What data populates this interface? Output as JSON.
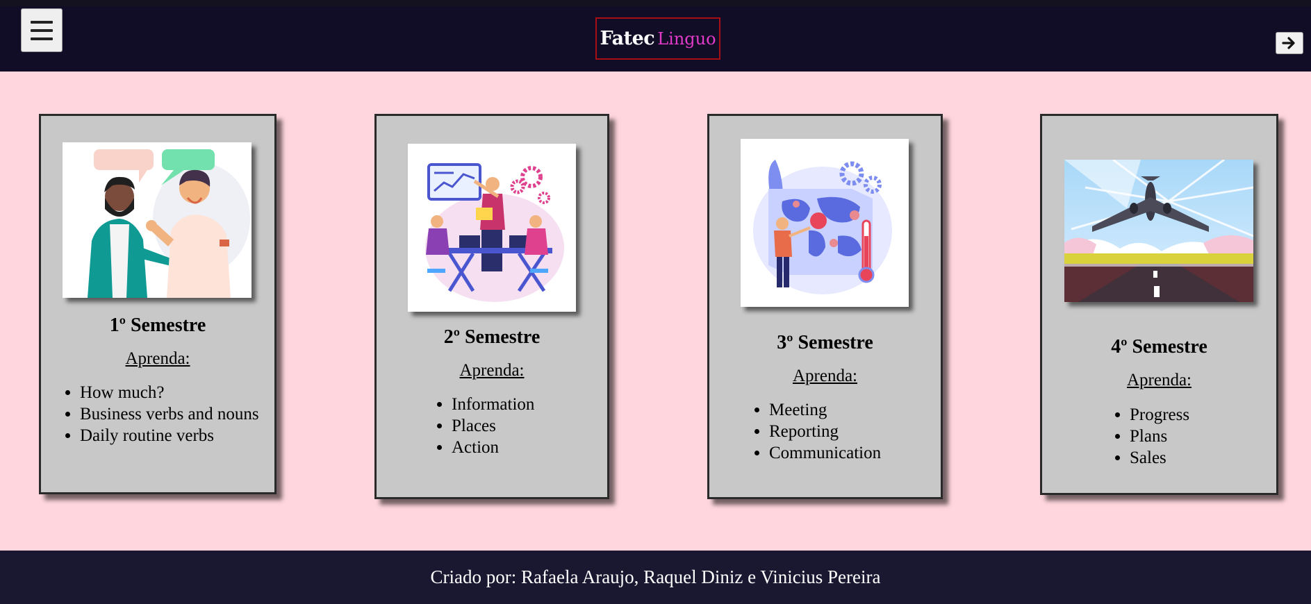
{
  "header": {
    "logo_part1": "Fatec",
    "logo_part2": "Linguo",
    "colors": {
      "bar": "#110d26",
      "logo_border": "#a80e16",
      "logo_accent": "#e23bc9"
    }
  },
  "icons": {
    "menu": "hamburger-icon",
    "exit": "arrow-right-icon"
  },
  "cards": [
    {
      "title": "1º Semestre",
      "learn_label": "Aprenda:",
      "image": "conversation-illustration",
      "items": [
        "How much?",
        "Business verbs and nouns",
        "Daily routine verbs"
      ]
    },
    {
      "title": "2º Semestre",
      "learn_label": "Aprenda:",
      "image": "meeting-illustration",
      "items": [
        "Information",
        "Places",
        "Action"
      ]
    },
    {
      "title": "3º Semestre",
      "learn_label": "Aprenda:",
      "image": "world-map-illustration",
      "items": [
        "Meeting",
        "Reporting",
        "Communication"
      ]
    },
    {
      "title": "4º Semestre",
      "learn_label": "Aprenda:",
      "image": "airplane-takeoff-illustration",
      "items": [
        "Progress",
        "Plans",
        "Sales"
      ]
    }
  ],
  "footer": {
    "credits": "Criado por: Rafaela Araujo, Raquel Diniz e Vinicius Pereira"
  },
  "colors": {
    "page_background": "#ffd6dd",
    "card_background": "#c8c8c8",
    "footer_background": "#1a1730"
  }
}
